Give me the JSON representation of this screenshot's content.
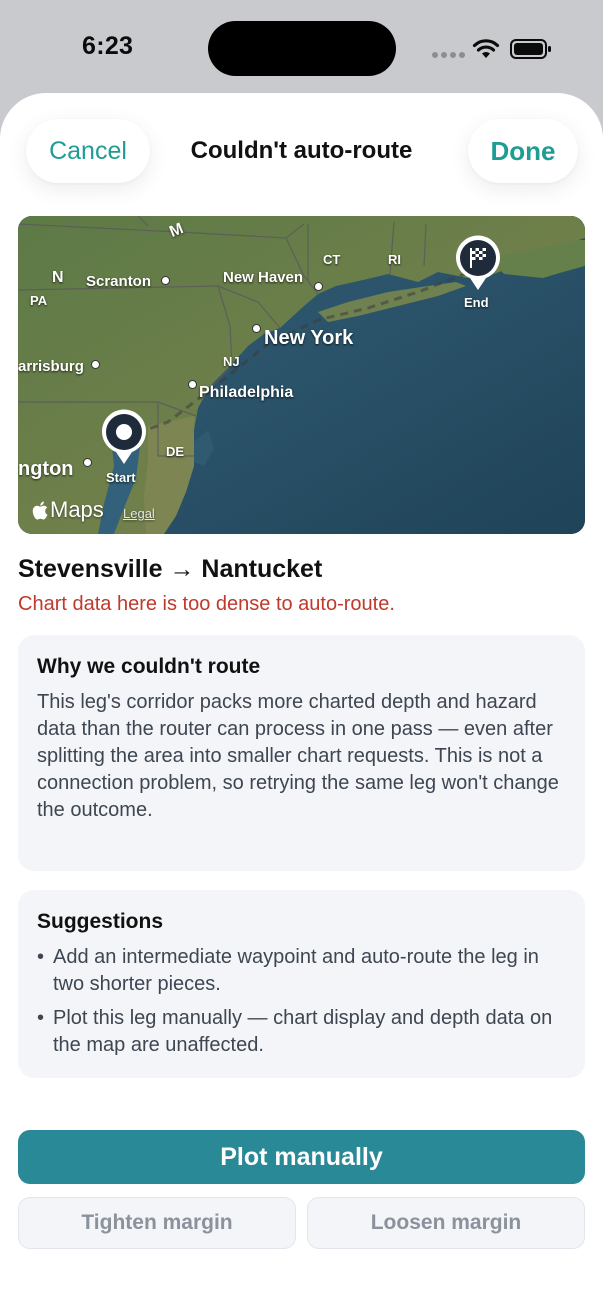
{
  "status_bar": {
    "time": "6:23"
  },
  "nav": {
    "cancel_label": "Cancel",
    "title": "Couldn't auto-route",
    "done_label": "Done"
  },
  "map": {
    "labels": {
      "m": "M",
      "n": "N",
      "pa": "PA",
      "scranton": "Scranton",
      "new_haven": "New Haven",
      "ct": "CT",
      "ri": "RI",
      "new_york": "New York",
      "nj": "NJ",
      "harrisburg": "arrisburg",
      "philadelphia": "Philadelphia",
      "de": "DE",
      "washington": "ngton",
      "start": "Start",
      "end": "End"
    },
    "brand": "Maps",
    "legal": "Legal",
    "icons": {
      "start_pin": "location-pin-icon",
      "end_pin": "checkered-flag-icon",
      "brand": "apple-logo-icon"
    }
  },
  "route": {
    "title": "Stevensville → Nantucket",
    "error": "Chart data here is too dense to auto-route."
  },
  "why_card": {
    "heading": "Why we couldn't route",
    "body": "This leg's corridor packs more charted depth and hazard data than the router can process in one pass — even after splitting the area into smaller chart requests. This is not a connection problem, so retrying the same leg won't change the outcome."
  },
  "suggestions_card": {
    "heading": "Suggestions",
    "items": [
      "Add an intermediate waypoint and auto-route the leg in two shorter pieces.",
      "Plot this leg manually — chart display and depth data on the map are unaffected."
    ]
  },
  "actions": {
    "primary_label": "Plot manually",
    "tighten_label": "Tighten margin",
    "loosen_label": "Loosen margin"
  },
  "colors": {
    "accent": "#1f9c93",
    "primary_button": "#2a8996",
    "error": "#c0392b",
    "card_bg": "#f3f5f8"
  }
}
